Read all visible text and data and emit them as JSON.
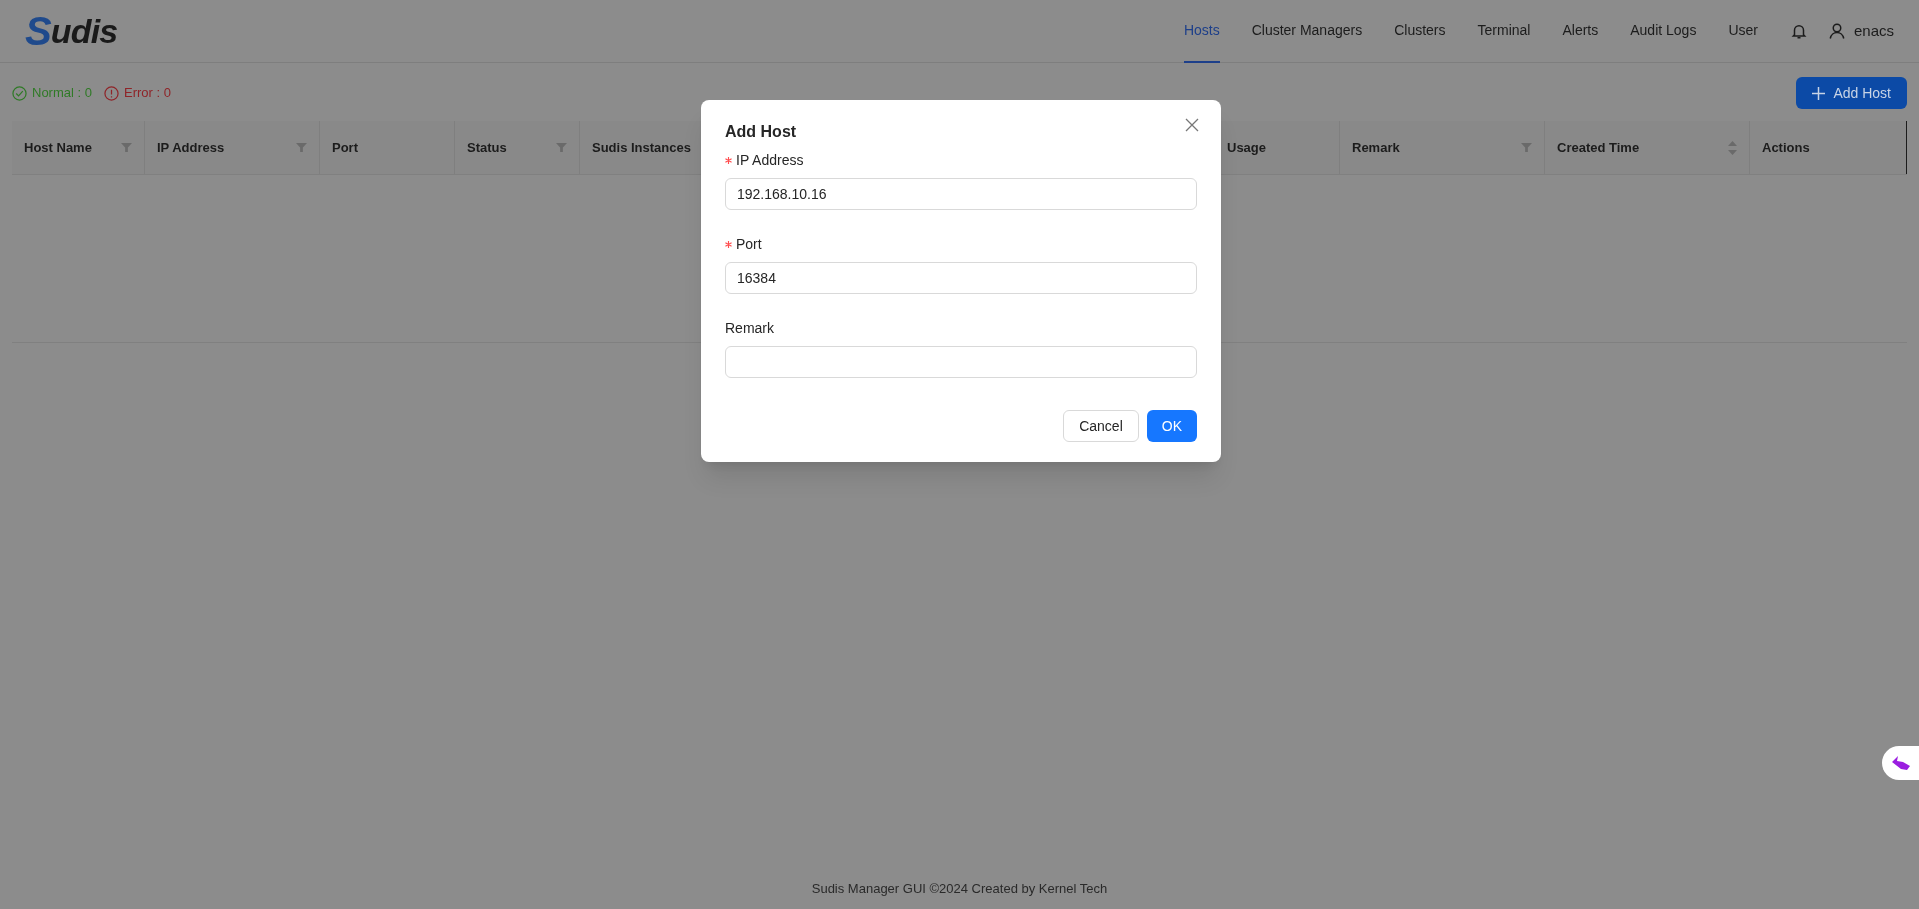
{
  "header": {
    "logo": "Sudis",
    "nav": [
      {
        "label": "Hosts",
        "selected": true
      },
      {
        "label": "Cluster Managers",
        "selected": false
      },
      {
        "label": "Clusters",
        "selected": false
      },
      {
        "label": "Terminal",
        "selected": false
      },
      {
        "label": "Alerts",
        "selected": false
      },
      {
        "label": "Audit Logs",
        "selected": false
      },
      {
        "label": "User",
        "selected": false
      }
    ],
    "user": "enacs"
  },
  "summary": [
    {
      "kind": "normal",
      "label": "Normal : 0"
    },
    {
      "kind": "error",
      "label": "Error : 0"
    }
  ],
  "add_button": "Add Host",
  "table": {
    "columns": [
      {
        "label": "Host Name",
        "kind": "filter"
      },
      {
        "label": "IP Address",
        "kind": "filter"
      },
      {
        "label": "Port",
        "kind": "plain"
      },
      {
        "label": "Status",
        "kind": "filter"
      },
      {
        "label": "Sudis Instances",
        "kind": "plain"
      },
      {
        "label": "Usage",
        "kind": "plain"
      },
      {
        "label": "Remark",
        "kind": "filter"
      },
      {
        "label": "Created Time",
        "kind": "sort"
      },
      {
        "label": "Actions",
        "kind": "plain"
      }
    ]
  },
  "dialog": {
    "title": "Add Host",
    "fields": [
      {
        "label": "IP Address",
        "required": true,
        "value": "192.168.10.16"
      },
      {
        "label": "Port",
        "required": true,
        "value": "16384"
      },
      {
        "label": "Remark",
        "required": false
      }
    ],
    "buttons": [
      {
        "label": "Cancel",
        "kind": "default"
      },
      {
        "label": "OK",
        "kind": "primary"
      }
    ]
  },
  "footer": "Sudis Manager GUI ©2024 Created by Kernel Tech"
}
